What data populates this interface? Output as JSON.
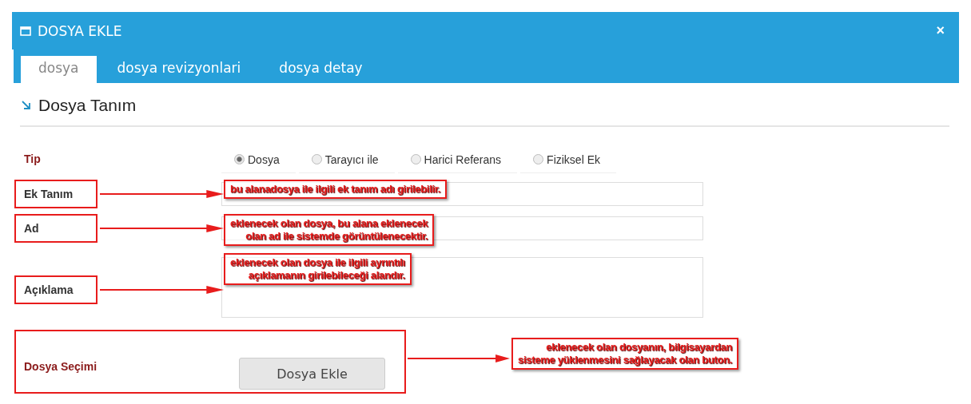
{
  "window": {
    "title": "DOSYA EKLE",
    "close": "×"
  },
  "tabs": [
    {
      "label": "dosya",
      "selected": true
    },
    {
      "label": "dosya revizyonlari",
      "selected": false
    },
    {
      "label": "dosya detay",
      "selected": false
    }
  ],
  "section_title": "Dosya Tanım",
  "fields": [
    {
      "kind": "radio",
      "label": "Tip",
      "required": true,
      "highlighted": false,
      "options": [
        {
          "label": "Dosya",
          "selected": true
        },
        {
          "label": "Tarayıcı ile",
          "selected": false
        },
        {
          "label": "Harici Referans",
          "selected": false
        },
        {
          "label": "Fiziksel Ek",
          "selected": false
        }
      ]
    },
    {
      "kind": "text",
      "label": "Ek Tanım",
      "required": false,
      "highlighted": true,
      "annotation": "bu alanadosya ile ilgili ek tanım adı girilebilir."
    },
    {
      "kind": "text",
      "label": "Ad",
      "required": false,
      "highlighted": true,
      "annotation": "eklenecek olan dosya, bu alana eklenecek\nolan ad ile sistemde görüntülenecektir."
    },
    {
      "kind": "textarea",
      "label": "Açıklama",
      "required": false,
      "highlighted": true,
      "annotation": "eklenecek olan dosya ile ilgili ayrıntılı\naçıklamanın girilebileceği alandır."
    },
    {
      "kind": "button",
      "label": "Dosya Seçimi",
      "required": true,
      "highlighted": true,
      "button": "Dosya Ekle",
      "annotation": "eklenecek olan dosyanın, bilgisayardan\nsisteme yüklenmesini sağlayacak olan buton."
    }
  ]
}
